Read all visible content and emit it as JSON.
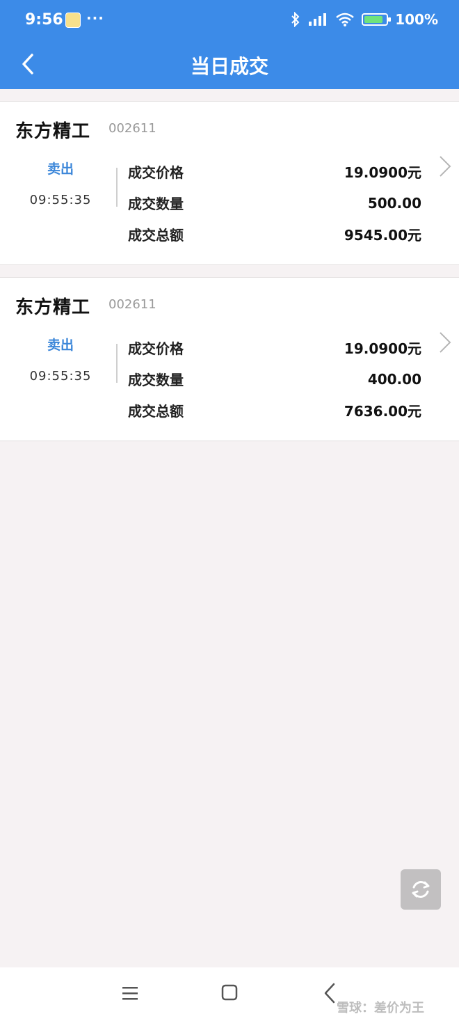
{
  "status": {
    "time": "9:56",
    "dots": "···",
    "battery": "100%"
  },
  "header": {
    "title": "当日成交"
  },
  "trades": [
    {
      "name": "东方精工",
      "code": "002611",
      "side": "卖出",
      "time": "09:55:35",
      "rows": [
        {
          "label": "成交价格",
          "value": "19.0900元"
        },
        {
          "label": "成交数量",
          "value": "500.00"
        },
        {
          "label": "成交总额",
          "value": "9545.00元"
        }
      ]
    },
    {
      "name": "东方精工",
      "code": "002611",
      "side": "卖出",
      "time": "09:55:35",
      "rows": [
        {
          "label": "成交价格",
          "value": "19.0900元"
        },
        {
          "label": "成交数量",
          "value": "400.00"
        },
        {
          "label": "成交总额",
          "value": "7636.00元"
        }
      ]
    }
  ],
  "watermark": "雪球：差价为王",
  "icons": {
    "back": "chevron-left-icon",
    "detail": "chevron-right-icon",
    "refresh": "refresh-icon",
    "nav_menu": "menu-icon",
    "nav_home": "square-home-icon",
    "nav_back": "back-triangle-icon"
  },
  "colors": {
    "header_bg": "#3c8be8",
    "side_text": "#3b86d9",
    "page_bg": "#f6f2f3"
  }
}
